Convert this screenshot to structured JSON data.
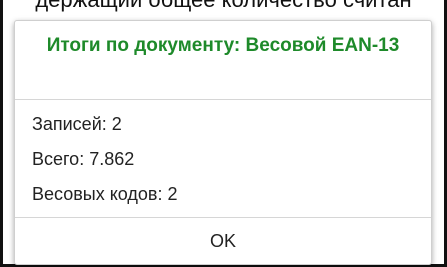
{
  "background": {
    "partial_text": "держащий общее количество считан"
  },
  "dialog": {
    "title": "Итоги по документу: Весовой EAN-13",
    "lines": [
      "Записей: 2",
      "Всего: 7.862",
      "Весовых кодов: 2"
    ],
    "ok_label": "OK"
  },
  "colors": {
    "title": "#1e8a2a",
    "text": "#222222",
    "divider": "#d6d6d6"
  }
}
